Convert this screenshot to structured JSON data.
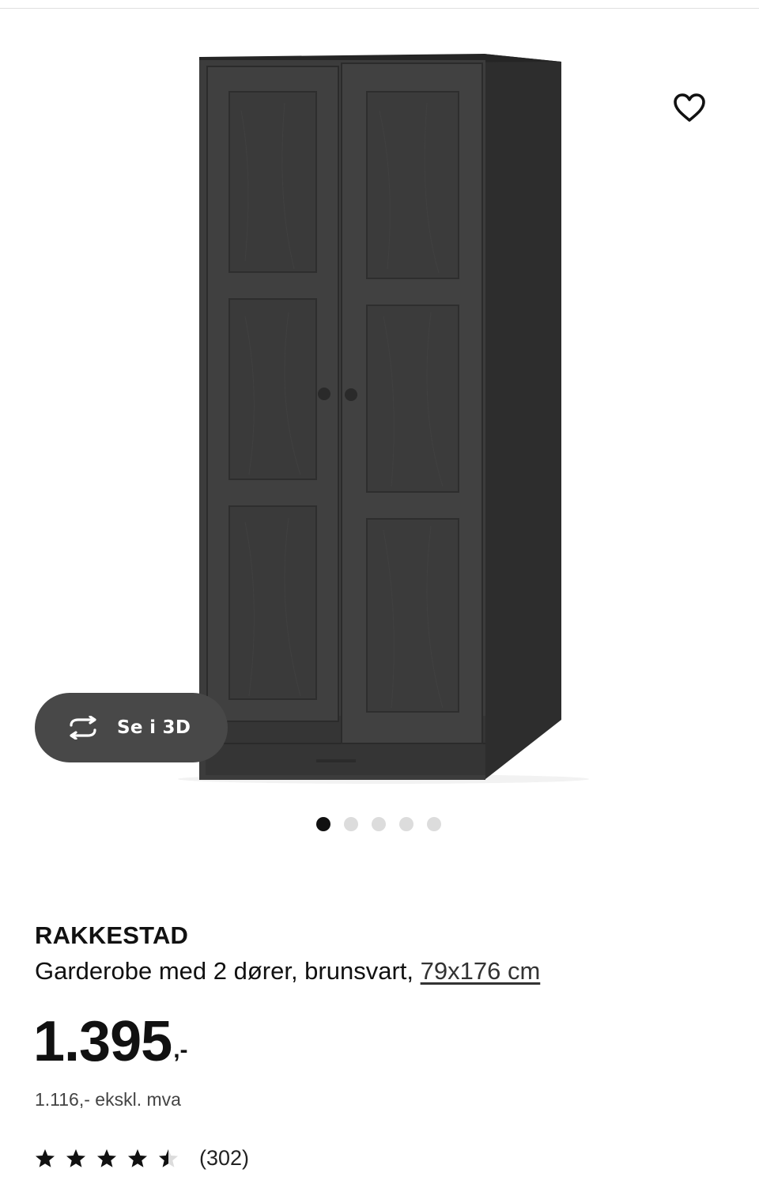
{
  "product": {
    "name": "RAKKESTAD",
    "description": "Garderobe med 2 dører, brunsvart,",
    "size_link": "79x176 cm",
    "price_main": "1.395",
    "price_suffix": ",-",
    "price_ex_vat": "1.116,- ekskl. mva",
    "rating": 4.5,
    "rating_max": 5,
    "review_count": "(302)"
  },
  "image_view": {
    "view3d_label": "Se i 3D",
    "carousel_count": 5,
    "carousel_active": 1,
    "favorite_icon": "heart-outline-icon",
    "view3d_icon": "rotate-3d-icon"
  },
  "colors": {
    "wardrobe": "#3b3b3b",
    "button_bg": "#484848",
    "text": "#111111"
  }
}
